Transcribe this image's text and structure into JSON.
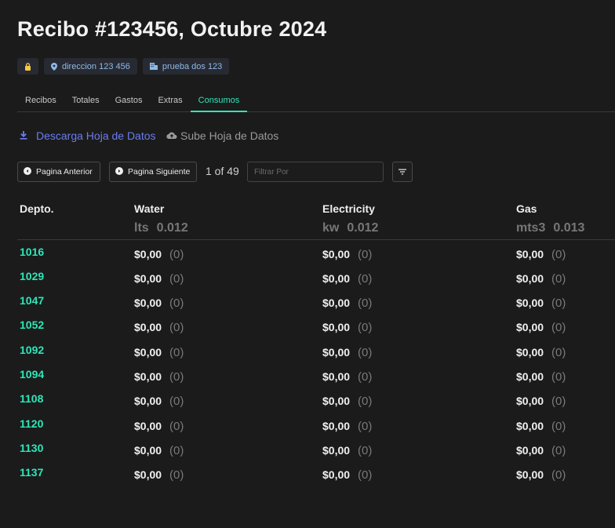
{
  "page": {
    "title": "Recibo #123456, Octubre 2024"
  },
  "chips": [
    {
      "icon": "lock-icon",
      "label": ""
    },
    {
      "icon": "location-pin-icon",
      "label": "direccion 123 456"
    },
    {
      "icon": "building-icon",
      "label": "prueba dos 123"
    }
  ],
  "tabs": [
    {
      "label": "Recibos",
      "active": false
    },
    {
      "label": "Totales",
      "active": false
    },
    {
      "label": "Gastos",
      "active": false
    },
    {
      "label": "Extras",
      "active": false
    },
    {
      "label": "Consumos",
      "active": true
    }
  ],
  "actions": {
    "download_label": "Descarga Hoja de Datos",
    "upload_label": "Sube Hoja de Datos"
  },
  "pagination": {
    "prev_label": "Pagina Anterior",
    "next_label": "Pagina Siguiente",
    "page_count": "1 of 49"
  },
  "filter": {
    "placeholder": "Filtrar Por",
    "value": ""
  },
  "table": {
    "columns": [
      {
        "label": "Depto.",
        "unit": "",
        "rate": ""
      },
      {
        "label": "Water",
        "unit": "lts",
        "rate": "0.012"
      },
      {
        "label": "Electricity",
        "unit": "kw",
        "rate": "0.012"
      },
      {
        "label": "Gas",
        "unit": "mts3",
        "rate": "0.013"
      }
    ],
    "rows": [
      {
        "depto": "1016",
        "water": {
          "amount": "$0,00",
          "qty": "(0)"
        },
        "electricity": {
          "amount": "$0,00",
          "qty": "(0)"
        },
        "gas": {
          "amount": "$0,00",
          "qty": "(0)"
        }
      },
      {
        "depto": "1029",
        "water": {
          "amount": "$0,00",
          "qty": "(0)"
        },
        "electricity": {
          "amount": "$0,00",
          "qty": "(0)"
        },
        "gas": {
          "amount": "$0,00",
          "qty": "(0)"
        }
      },
      {
        "depto": "1047",
        "water": {
          "amount": "$0,00",
          "qty": "(0)"
        },
        "electricity": {
          "amount": "$0,00",
          "qty": "(0)"
        },
        "gas": {
          "amount": "$0,00",
          "qty": "(0)"
        }
      },
      {
        "depto": "1052",
        "water": {
          "amount": "$0,00",
          "qty": "(0)"
        },
        "electricity": {
          "amount": "$0,00",
          "qty": "(0)"
        },
        "gas": {
          "amount": "$0,00",
          "qty": "(0)"
        }
      },
      {
        "depto": "1092",
        "water": {
          "amount": "$0,00",
          "qty": "(0)"
        },
        "electricity": {
          "amount": "$0,00",
          "qty": "(0)"
        },
        "gas": {
          "amount": "$0,00",
          "qty": "(0)"
        }
      },
      {
        "depto": "1094",
        "water": {
          "amount": "$0,00",
          "qty": "(0)"
        },
        "electricity": {
          "amount": "$0,00",
          "qty": "(0)"
        },
        "gas": {
          "amount": "$0,00",
          "qty": "(0)"
        }
      },
      {
        "depto": "1108",
        "water": {
          "amount": "$0,00",
          "qty": "(0)"
        },
        "electricity": {
          "amount": "$0,00",
          "qty": "(0)"
        },
        "gas": {
          "amount": "$0,00",
          "qty": "(0)"
        }
      },
      {
        "depto": "1120",
        "water": {
          "amount": "$0,00",
          "qty": "(0)"
        },
        "electricity": {
          "amount": "$0,00",
          "qty": "(0)"
        },
        "gas": {
          "amount": "$0,00",
          "qty": "(0)"
        }
      },
      {
        "depto": "1130",
        "water": {
          "amount": "$0,00",
          "qty": "(0)"
        },
        "electricity": {
          "amount": "$0,00",
          "qty": "(0)"
        },
        "gas": {
          "amount": "$0,00",
          "qty": "(0)"
        }
      },
      {
        "depto": "1137",
        "water": {
          "amount": "$0,00",
          "qty": "(0)"
        },
        "electricity": {
          "amount": "$0,00",
          "qty": "(0)"
        },
        "gas": {
          "amount": "$0,00",
          "qty": "(0)"
        }
      }
    ]
  },
  "colors": {
    "background": "#1b1b1b",
    "accent_teal": "#2ee6b8",
    "link_blue": "#6a7cf0",
    "chip_text": "#8fb8e8",
    "lock_yellow": "#f5c84a"
  }
}
